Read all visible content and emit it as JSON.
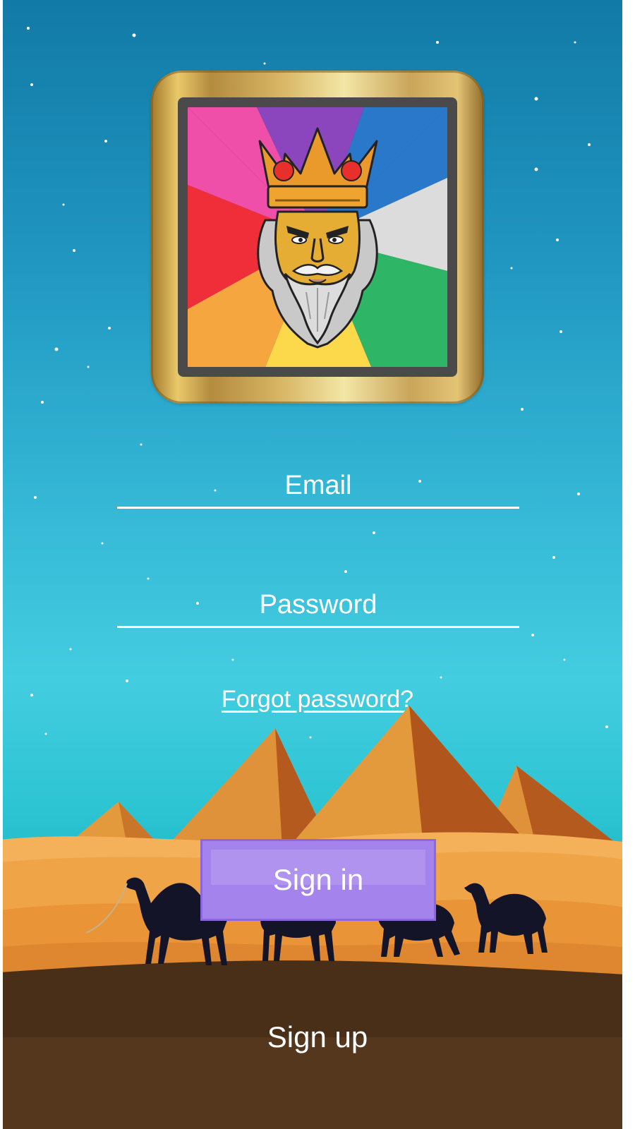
{
  "login": {
    "email_placeholder": "Email",
    "password_placeholder": "Password",
    "forgot_label": "Forgot password?",
    "signin_label": "Sign in",
    "signup_label": "Sign up"
  },
  "colors": {
    "sky_top": "#127aa6",
    "sky_bottom": "#2cc4d2",
    "sign_in_button": "#a484ec",
    "sand": "#f0a448",
    "ground": "#3f2a17"
  },
  "icons": {
    "logo": "king-with-crown-icon",
    "decoration": [
      "pyramid-icon",
      "camel-icon"
    ]
  }
}
